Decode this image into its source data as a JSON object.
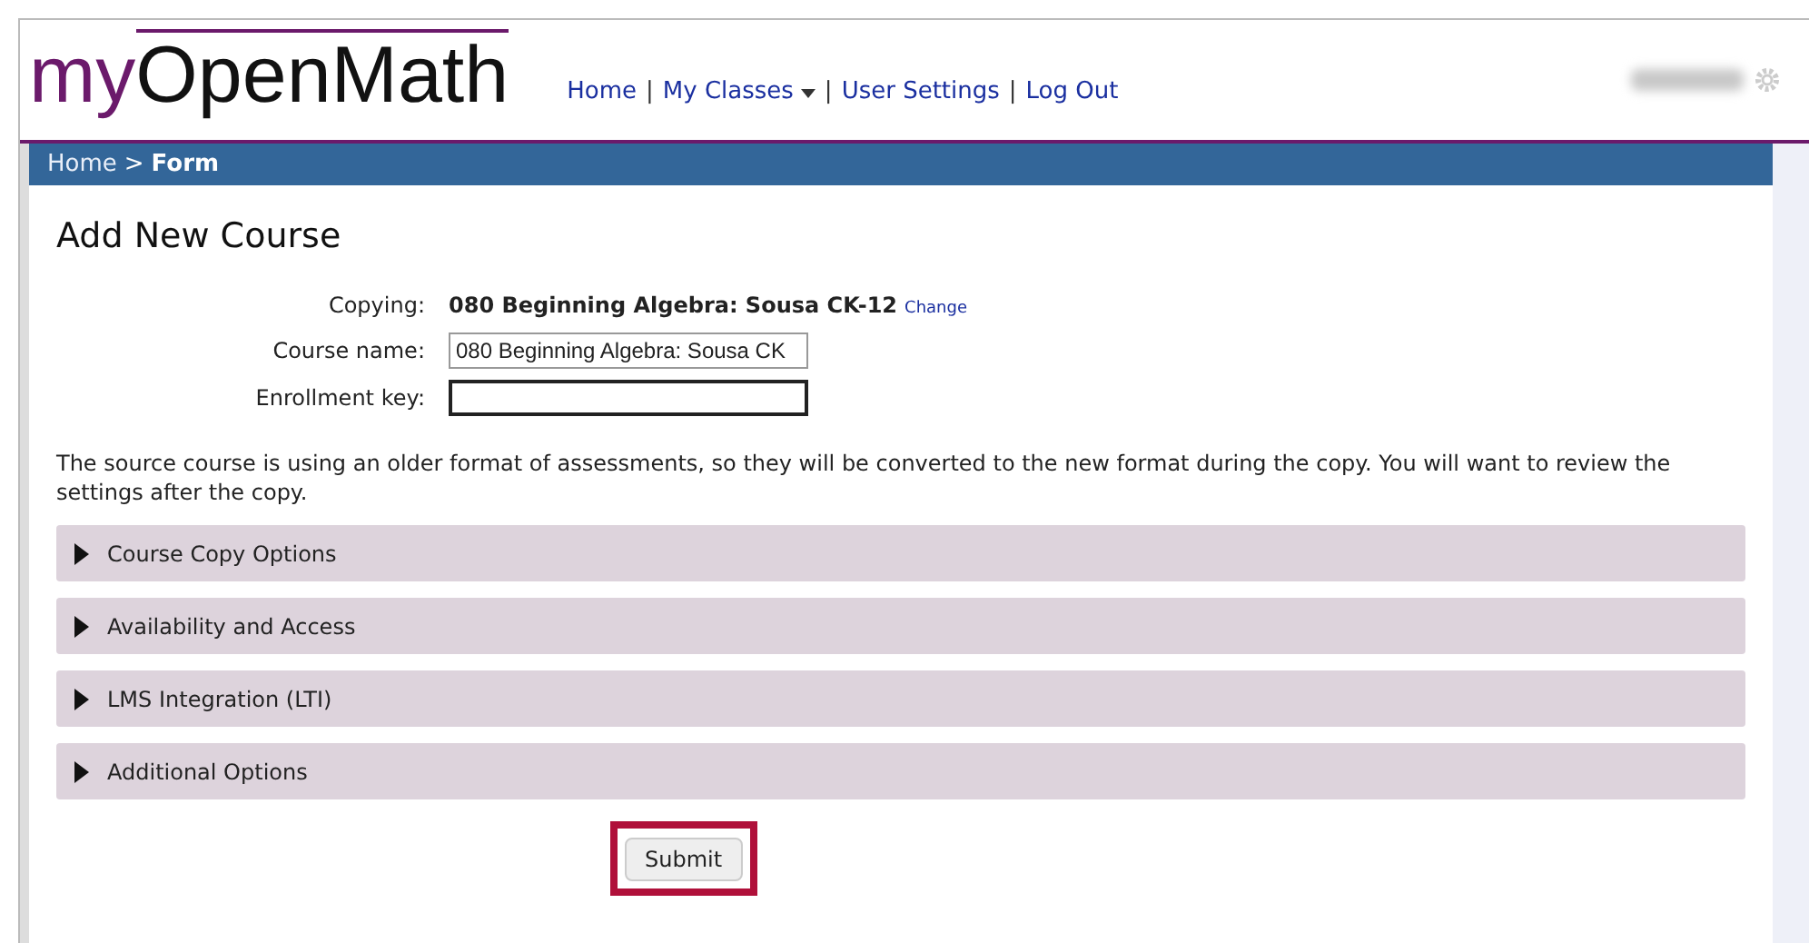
{
  "logo": {
    "prefix": "my",
    "name": "OpenMath"
  },
  "nav": [
    {
      "kind": "link",
      "label": "Home",
      "dropdown": false
    },
    {
      "kind": "separator",
      "label": "|"
    },
    {
      "kind": "link",
      "label": "My Classes",
      "dropdown": true
    },
    {
      "kind": "separator",
      "label": "|"
    },
    {
      "kind": "link",
      "label": "User Settings",
      "dropdown": false
    },
    {
      "kind": "separator",
      "label": "|"
    },
    {
      "kind": "link",
      "label": "Log Out",
      "dropdown": false
    }
  ],
  "breadcrumb": [
    {
      "label": "Home",
      "current": false
    },
    {
      "kind": "separator",
      "label": ">"
    },
    {
      "label": "Form",
      "current": true
    }
  ],
  "heading": "Add New Course",
  "form": {
    "copying_label": "Copying:",
    "copying_value": "080 Beginning Algebra: Sousa CK-12",
    "change_link": "Change",
    "course_name_label": "Course name:",
    "course_name_value": "080 Beginning Algebra: Sousa CK",
    "enrollment_key_label": "Enrollment key:",
    "enrollment_key_focused": true
  },
  "notice": "The source course is using an older format of assessments, so they will be converted to the new format during the copy. You will want to review the settings after the copy.",
  "sections": [
    {
      "label": "Course Copy Options",
      "expanded": false
    },
    {
      "label": "Availability and Access",
      "expanded": false
    },
    {
      "label": "LMS Integration (LTI)",
      "expanded": false
    },
    {
      "label": "Additional Options",
      "expanded": false
    }
  ],
  "submit": {
    "label": "Submit",
    "highlighted": true
  }
}
